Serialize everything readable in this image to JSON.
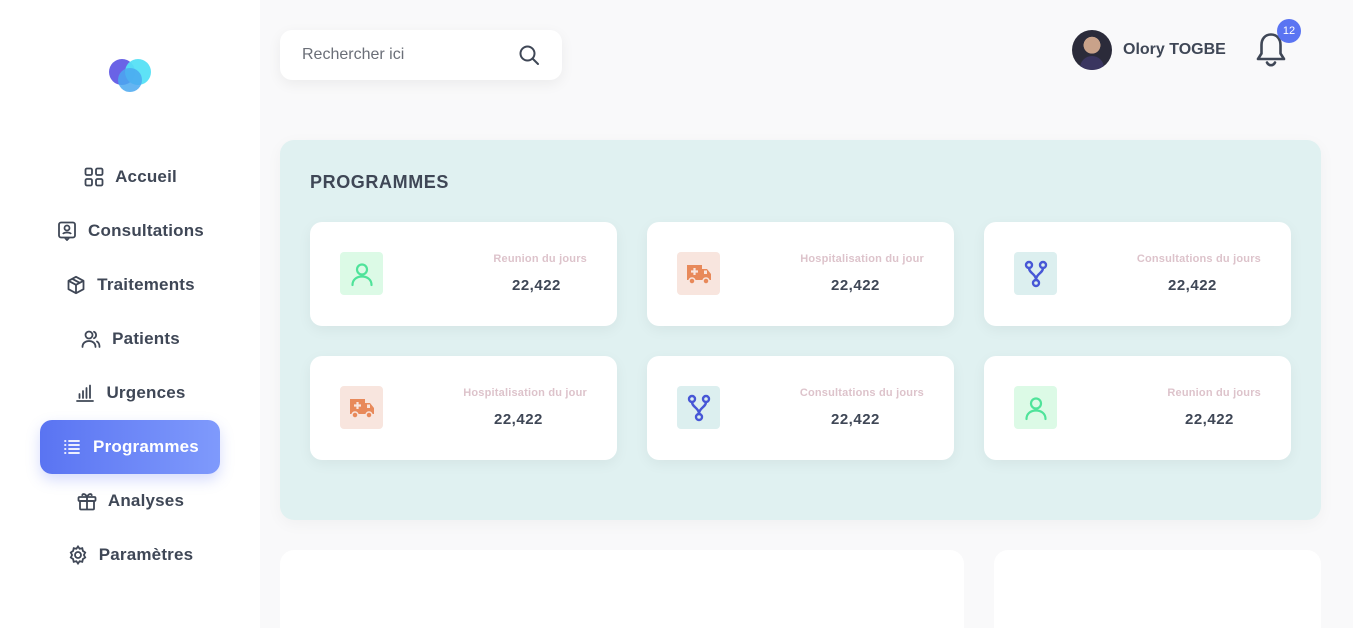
{
  "sidebar": {
    "items": [
      {
        "label": "Accueil",
        "icon": "grid-icon"
      },
      {
        "label": "Consultations",
        "icon": "consultation-icon"
      },
      {
        "label": "Traitements",
        "icon": "box-icon"
      },
      {
        "label": "Patients",
        "icon": "users-icon"
      },
      {
        "label": "Urgences",
        "icon": "bar-chart-icon"
      },
      {
        "label": "Programmes",
        "icon": "list-icon",
        "active": true
      },
      {
        "label": "Analyses",
        "icon": "gift-icon"
      },
      {
        "label": "Paramètres",
        "icon": "gear-icon"
      }
    ]
  },
  "search": {
    "placeholder": "Rechercher ici",
    "value": ""
  },
  "user": {
    "name": "Olory TOGBE"
  },
  "notifications": {
    "count": "12"
  },
  "programmes": {
    "title": "PROGRAMMES",
    "cards": [
      {
        "label": "Reunion du jours",
        "value": "22,422",
        "icon": "user-icon",
        "color": "#4fe39a"
      },
      {
        "label": "Hospitalisation du jour",
        "value": "22,422",
        "icon": "ambulance-icon",
        "color": "#e8895a"
      },
      {
        "label": "Consultations du jours",
        "value": "22,422",
        "icon": "fork-icon",
        "color": "#4757d6"
      },
      {
        "label": "Hospitalisation du jour",
        "value": "22,422",
        "icon": "ambulance-icon",
        "color": "#e8895a"
      },
      {
        "label": "Consultations du jours",
        "value": "22,422",
        "icon": "fork-icon",
        "color": "#4757d6"
      },
      {
        "label": "Reunion du jours",
        "value": "22,422",
        "icon": "user-icon",
        "color": "#4fe39a"
      }
    ]
  },
  "colors": {
    "accent": "#5a74f2",
    "panel": "#e0f1f1"
  }
}
